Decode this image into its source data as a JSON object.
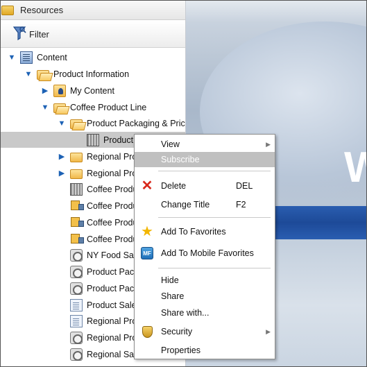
{
  "panel": {
    "title": "Resources",
    "filter_label": "Filter"
  },
  "tree": [
    {
      "label": "Content",
      "icon": "content-icon",
      "indent": 0,
      "arrow": "expanded"
    },
    {
      "label": "Product Information",
      "icon": "folder-open-icon",
      "indent": 1,
      "arrow": "expanded"
    },
    {
      "label": "My Content",
      "icon": "my-content-folder-icon",
      "indent": 2,
      "arrow": "collapsed"
    },
    {
      "label": "Coffee Product Line",
      "icon": "folder-open-icon",
      "indent": 2,
      "arrow": "expanded"
    },
    {
      "label": "Product Packaging & Pric",
      "icon": "folder-open-icon",
      "indent": 3,
      "arrow": "expanded"
    },
    {
      "label": "Product",
      "icon": "report-icon",
      "indent": 4,
      "arrow": "none",
      "selected": true
    },
    {
      "label": "Regional Pro",
      "icon": "folder-icon",
      "indent": 3,
      "arrow": "collapsed"
    },
    {
      "label": "Regional Pro",
      "icon": "folder-icon",
      "indent": 3,
      "arrow": "collapsed"
    },
    {
      "label": "Coffee Produ",
      "icon": "report-icon",
      "indent": 3,
      "arrow": "none"
    },
    {
      "label": "Coffee Produ",
      "icon": "truck-icon",
      "indent": 3,
      "arrow": "none"
    },
    {
      "label": "Coffee Produ",
      "icon": "truck-icon",
      "indent": 3,
      "arrow": "none"
    },
    {
      "label": "Coffee Produ",
      "icon": "truck-icon",
      "indent": 3,
      "arrow": "none"
    },
    {
      "label": "NY Food Sal",
      "icon": "gear-icon",
      "indent": 3,
      "arrow": "none"
    },
    {
      "label": "Product Pack",
      "icon": "gear-icon",
      "indent": 3,
      "arrow": "none"
    },
    {
      "label": "Product Pack",
      "icon": "gear-icon",
      "indent": 3,
      "arrow": "none"
    },
    {
      "label": "Product Sale",
      "icon": "document-icon",
      "indent": 3,
      "arrow": "none"
    },
    {
      "label": "Regional Pro",
      "icon": "document-icon",
      "indent": 3,
      "arrow": "none"
    },
    {
      "label": "Regional Pro",
      "icon": "gear-icon",
      "indent": 3,
      "arrow": "none"
    },
    {
      "label": "Regional Sal",
      "icon": "gear-icon",
      "indent": 3,
      "arrow": "none"
    }
  ],
  "context_menu": {
    "view": "View",
    "subscribe": "Subscribe",
    "delete": "Delete",
    "delete_shortcut": "DEL",
    "change_title": "Change Title",
    "change_title_shortcut": "F2",
    "add_favorites": "Add To Favorites",
    "add_mobile_favorites": "Add To Mobile Favorites",
    "mobile_icon_text": "MF",
    "hide": "Hide",
    "share": "Share",
    "share_with": "Share with...",
    "security": "Security",
    "properties": "Properties"
  },
  "background_letter": "W",
  "colors": {
    "accent_blue": "#1d4a98",
    "selection_gray": "#c9c9c9",
    "menu_hover": "#c0c0c0",
    "delete_red": "#d8281c",
    "favorite_gold": "#f2b600"
  }
}
